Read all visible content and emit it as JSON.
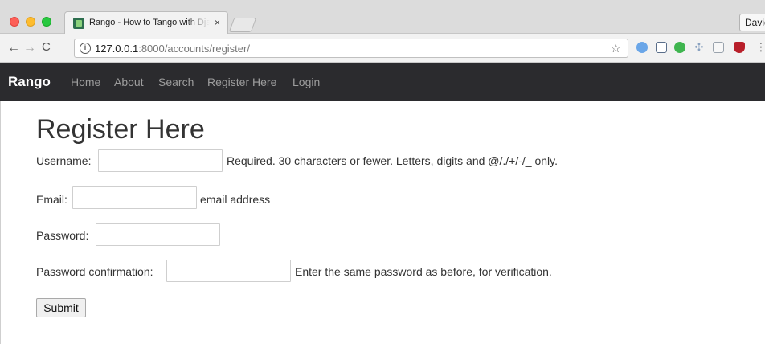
{
  "browser": {
    "tab_title": "Rango - How to Tango with Django",
    "tab_close": "×",
    "profile_name": "David",
    "url_host": "127.0.0.1",
    "url_path": ":8000/accounts/register/",
    "icons": {
      "back": "←",
      "forward": "→",
      "reload": "C",
      "info": "i",
      "star": "☆",
      "menu": "⋮"
    }
  },
  "navbar": {
    "brand": "Rango",
    "links": [
      "Home",
      "About",
      "Search",
      "Register Here",
      "Login"
    ]
  },
  "page": {
    "title": "Register Here",
    "fields": {
      "username": {
        "label": "Username:",
        "value": "",
        "help": "Required. 30 characters or fewer. Letters, digits and @/./+/-/_ only."
      },
      "email": {
        "label": "Email:",
        "value": "",
        "help": "email address"
      },
      "password": {
        "label": "Password:",
        "value": "",
        "help": ""
      },
      "password_confirmation": {
        "label": "Password confirmation:",
        "value": "",
        "help": "Enter the same password as before, for verification."
      }
    },
    "submit_label": "Submit"
  },
  "colors": {
    "navbar_bg": "#2b2b2e",
    "navbar_link": "#9d9d9d",
    "brand": "#ffffff",
    "text": "#333333"
  }
}
